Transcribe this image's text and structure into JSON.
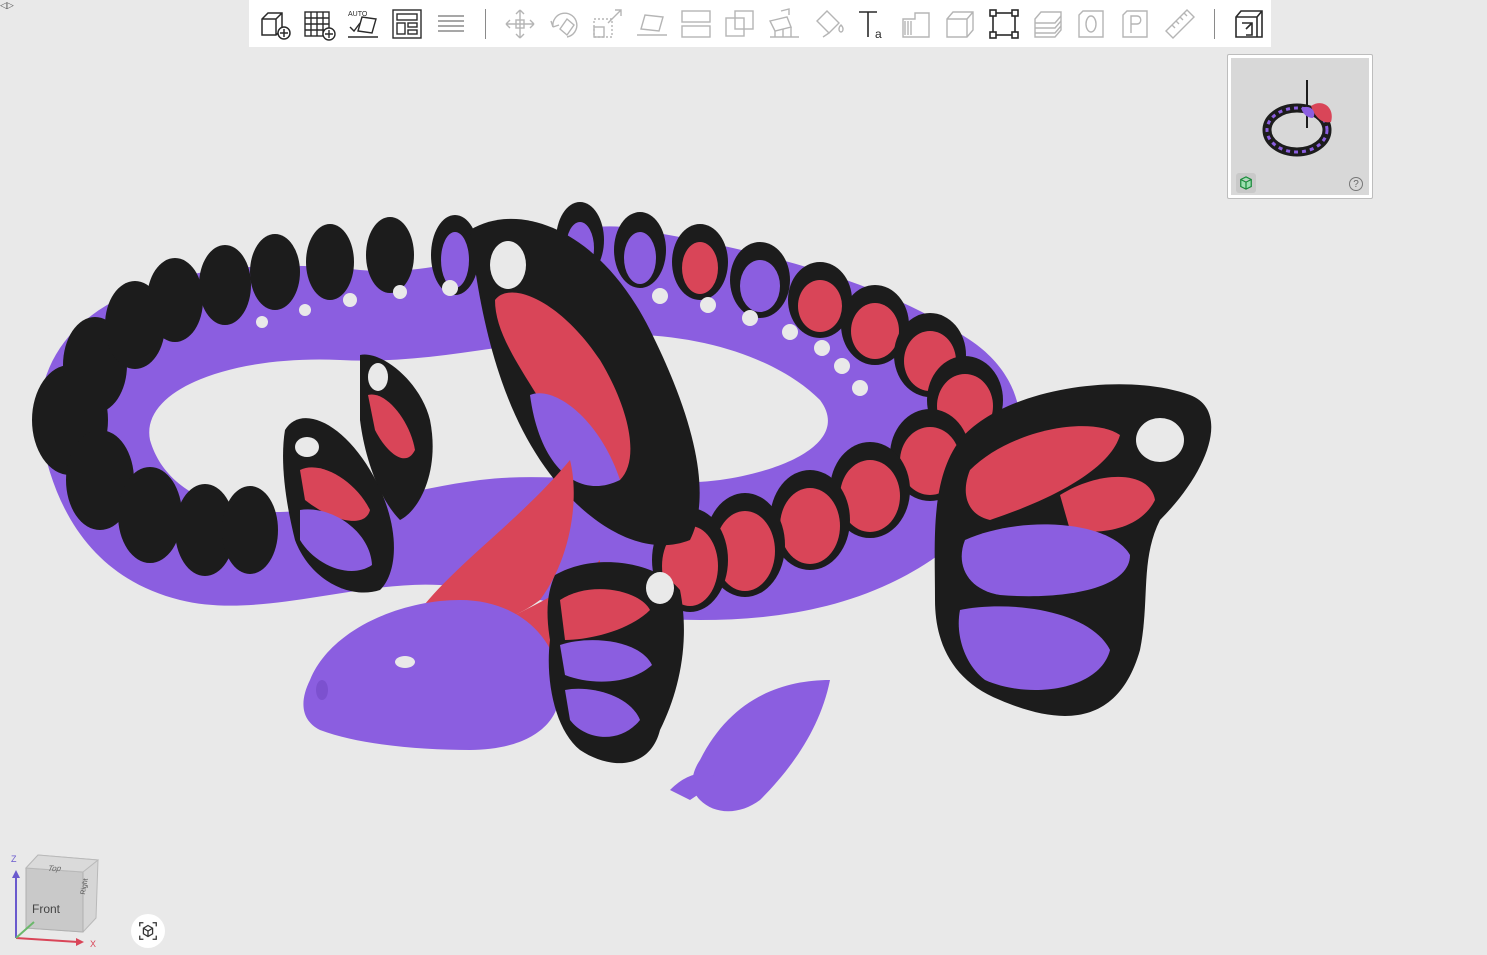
{
  "toolbar": {
    "groups": [
      [
        "add-object",
        "add-plate",
        "auto-orient",
        "arrange",
        "layers"
      ],
      [
        "move",
        "rotate",
        "scale",
        "lay-on-face",
        "split",
        "boolean",
        "support-paint",
        "seam-paint",
        "text-emboss",
        "variable-layer-height",
        "cube-primitive",
        "fit-view",
        "slice-all",
        "assembly-zero",
        "assembly-part",
        "measure"
      ],
      [
        "plate-sliced"
      ]
    ]
  },
  "thumbnail": {
    "help_label": "?"
  },
  "navcube": {
    "front_label": "Front",
    "top_label": "Top",
    "side_label": "Right",
    "axis_z": "Z",
    "axis_x": "X"
  },
  "colors": {
    "background": "#e9e9e9",
    "purple": "#8b5ee0",
    "red": "#d94558",
    "black": "#1c1c1c",
    "white": "#e9e9e9"
  }
}
